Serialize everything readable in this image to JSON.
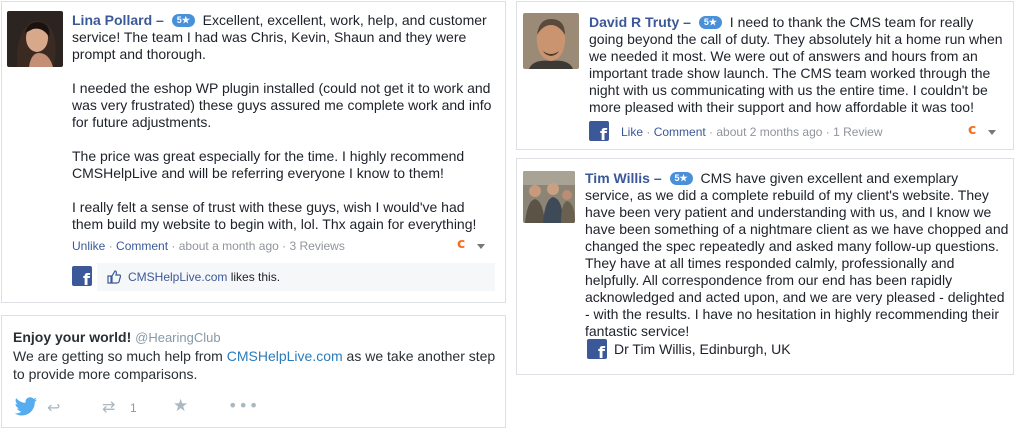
{
  "reviews": [
    {
      "name": "Lina Pollard",
      "dash": "–",
      "rating": "5★",
      "paragraphs": [
        "Excellent, excellent, work, help, and customer service! The team I had was Chris, Kevin, Shaun and they were prompt and thorough.",
        "I needed the eshop WP plugin installed (could not get it to work and was very frustrated) these guys assured me complete work and info for future adjustments.",
        "The price was great especially for the time. I highly recommend CMSHelpLive and will be referring everyone I know to them!",
        "I really felt a sense of trust with these guys, wish I would've had them build my website to begin with, lol. Thx again for everything!"
      ],
      "actions": {
        "action1": "Unlike",
        "action2": "Comment",
        "time": "about a month ago",
        "count": "3 Reviews"
      },
      "like_bar": {
        "page": "CMSHelpLive.com",
        "suffix": " likes this."
      }
    },
    {
      "name": "David R Truty",
      "dash": "–",
      "rating": "5★",
      "text": "I need to thank the CMS team for really going beyond the call of duty. They absolutely hit a home run when we needed it most. We were out of answers and hours from an important trade show launch. The CMS team worked through the night with us communicating with us the entire time. I couldn't be more pleased with their support and how affordable it was too!",
      "actions": {
        "action1": "Like",
        "action2": "Comment",
        "time": "about 2 months ago",
        "count": "1 Review"
      }
    },
    {
      "name": "Tim Willis",
      "dash": "–",
      "rating": "5★",
      "text": "CMS have given excellent and exemplary service, as we did a complete rebuild of my client's website. They have been very patient and understanding with us, and I know we have been something of a nightmare client as we have chopped and changed the spec repeatedly and asked many follow-up questions. They have at all times responded calmly, professionally and helpfully. All correspondence from our end has been rapidly acknowledged and acted upon, and we are very pleased - delighted - with the results. I have no hesitation in highly recommending their fantastic service!",
      "signature": "Dr Tim Willis, Edinburgh, UK"
    }
  ],
  "tweet": {
    "title": "Enjoy your world!",
    "handle": "@HearingClub",
    "text_before": "We are getting so much help from ",
    "link": "CMSHelpLive.com",
    "text_after": " as we take another step to provide more comparisons.",
    "retweet_count": "1"
  },
  "icons": {
    "facebook": "facebook-icon",
    "twitter": "twitter-bird-icon",
    "reply": "reply-icon",
    "retweet": "retweet-icon",
    "favorite": "star-icon",
    "more": "more-dots-icon",
    "thumb": "thumbs-up-icon",
    "cms": "cms-logo-icon"
  },
  "colors": {
    "facebook_blue": "#3b5998",
    "link_blue": "#2b7bb9",
    "badge_blue": "#4a90d9",
    "cms_orange": "#f36f21",
    "twitter_blue": "#55acee"
  }
}
